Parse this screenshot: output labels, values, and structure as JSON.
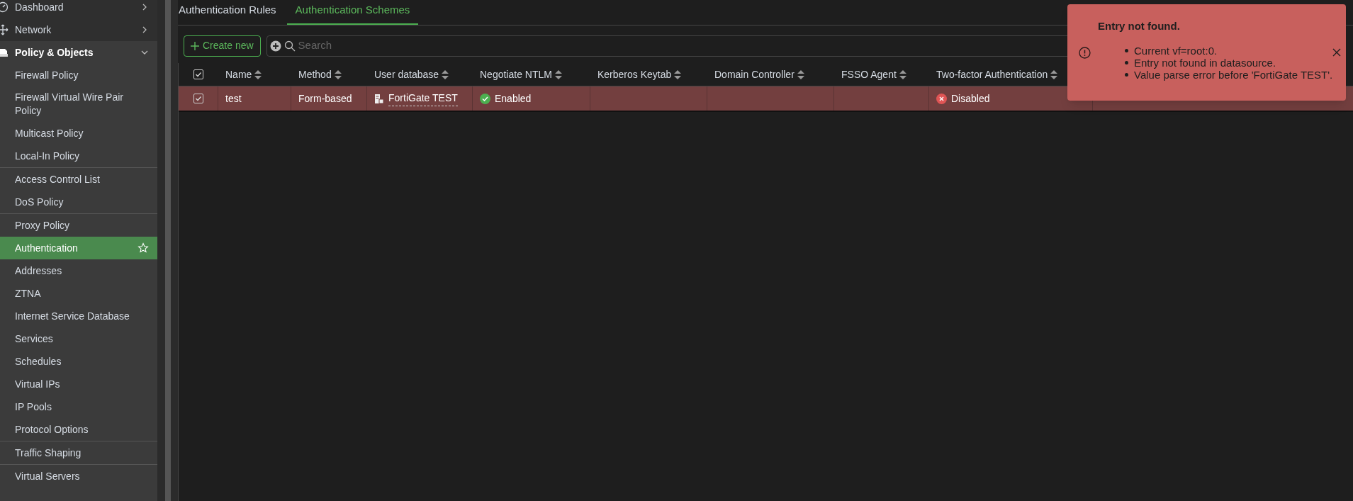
{
  "sidebar": {
    "sections": [
      {
        "label": "Dashboard",
        "expanded": false
      },
      {
        "label": "Network",
        "expanded": false
      },
      {
        "label": "Policy & Objects",
        "expanded": true,
        "groups": [
          [
            {
              "label": "Firewall Policy",
              "selected": false
            },
            {
              "label": "Firewall Virtual Wire Pair Policy",
              "selected": false
            },
            {
              "label": "Multicast Policy",
              "selected": false
            },
            {
              "label": "Local-In Policy",
              "selected": false
            }
          ],
          [
            {
              "label": "Access Control List",
              "selected": false
            },
            {
              "label": "DoS Policy",
              "selected": false
            }
          ],
          [
            {
              "label": "Proxy Policy",
              "selected": false
            },
            {
              "label": "Authentication",
              "selected": true
            },
            {
              "label": "Addresses",
              "selected": false
            },
            {
              "label": "ZTNA",
              "selected": false
            },
            {
              "label": "Internet Service Database",
              "selected": false
            },
            {
              "label": "Services",
              "selected": false
            },
            {
              "label": "Schedules",
              "selected": false
            },
            {
              "label": "Virtual IPs",
              "selected": false
            },
            {
              "label": "IP Pools",
              "selected": false
            },
            {
              "label": "Protocol Options",
              "selected": false
            }
          ],
          [
            {
              "label": "Traffic Shaping",
              "selected": false
            }
          ],
          [
            {
              "label": "Virtual Servers",
              "selected": false
            }
          ]
        ]
      }
    ]
  },
  "tabs": [
    {
      "label": "Authentication Rules",
      "selected": false
    },
    {
      "label": "Authentication Schemes",
      "selected": true
    }
  ],
  "toolbar": {
    "create_button": "Create new",
    "search": {
      "placeholder": "Search"
    }
  },
  "table": {
    "header_checked": true,
    "columns": [
      "Name",
      "Method",
      "User database",
      "Negotiate NTLM",
      "Kerberos Keytab",
      "Domain Controller",
      "FSSO Agent",
      "Two-factor Authentication"
    ],
    "rows": [
      {
        "selected": true,
        "checked": true,
        "cells": [
          {
            "kind": "text",
            "text": "test"
          },
          {
            "kind": "text",
            "text": "Form-based"
          },
          {
            "kind": "database",
            "text": "FortiGate TEST"
          },
          {
            "kind": "status",
            "text": "Enabled",
            "enabled": true
          },
          {
            "kind": "empty"
          },
          {
            "kind": "empty"
          },
          {
            "kind": "empty"
          },
          {
            "kind": "status",
            "text": "Disabled",
            "enabled": false
          }
        ]
      }
    ]
  },
  "toast": {
    "title": "Entry not found.",
    "messages": [
      "Current vf=root:0.",
      "Entry not found in datasource.",
      "Value parse error before 'FortiGate TEST'."
    ]
  }
}
